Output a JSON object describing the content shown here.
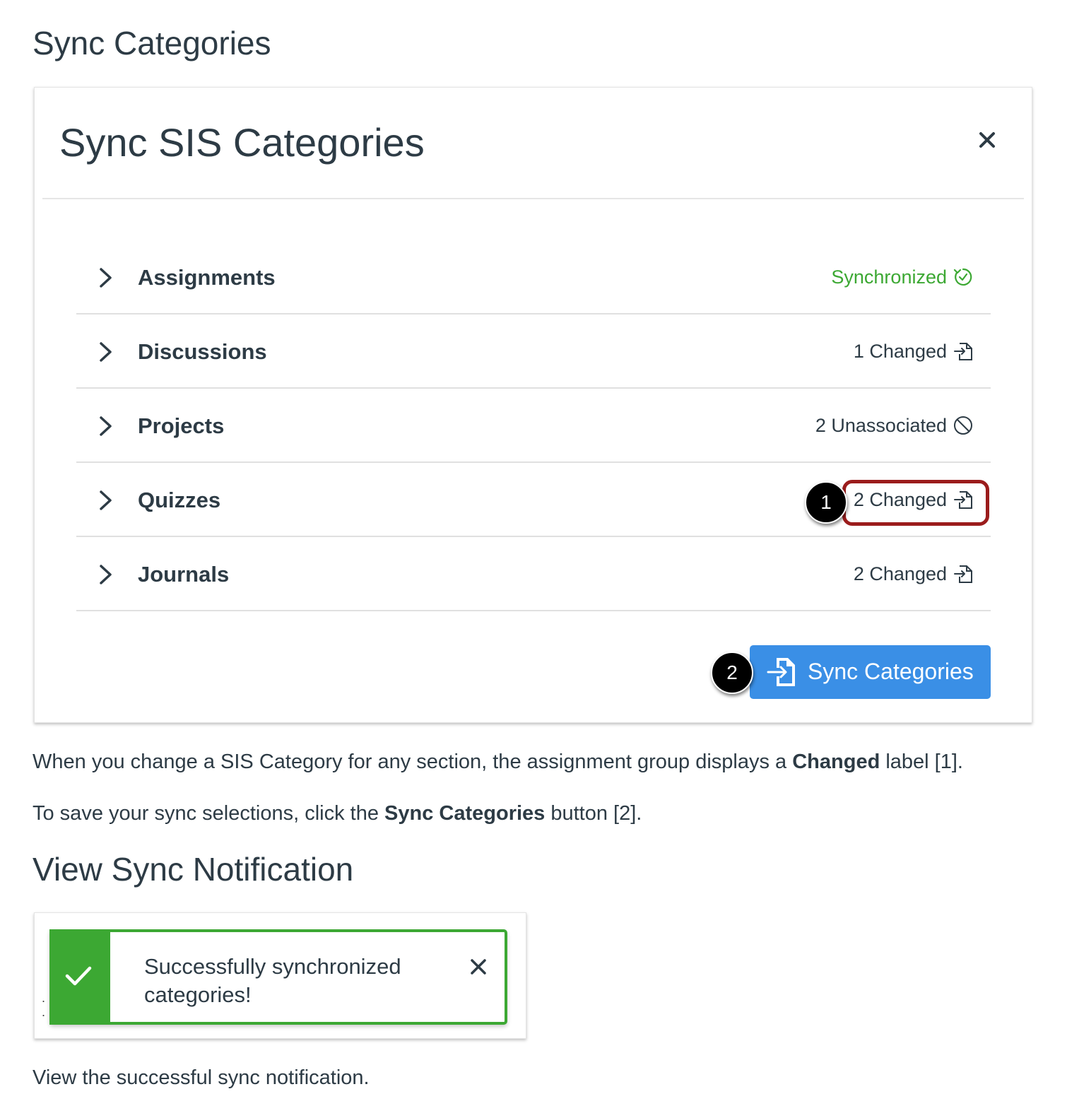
{
  "headings": {
    "sync_categories": "Sync Categories",
    "view_sync_notification": "View Sync Notification"
  },
  "modal": {
    "title": "Sync SIS Categories",
    "rows": [
      {
        "name": "Assignments",
        "status": "Synchronized",
        "status_icon": "synchronized-check-icon"
      },
      {
        "name": "Discussions",
        "status": "1 Changed",
        "status_icon": "changed-file-icon"
      },
      {
        "name": "Projects",
        "status": "2 Unassociated",
        "status_icon": "unassociated-icon"
      },
      {
        "name": "Quizzes",
        "status": "2 Changed",
        "status_icon": "changed-file-icon"
      },
      {
        "name": "Journals",
        "status": "2 Changed",
        "status_icon": "changed-file-icon"
      }
    ],
    "sync_button_label": "Sync Categories"
  },
  "callouts": {
    "badge1": "1",
    "badge2": "2"
  },
  "paragraphs": {
    "p1_pre": "When you change a SIS Category for any section, the assignment group displays a ",
    "p1_bold": "Changed",
    "p1_post": " label [1].",
    "p2_pre": "To save your sync selections, click the ",
    "p2_bold": "Sync Categories",
    "p2_post": " button [2].",
    "p3": "View the successful sync notification."
  },
  "notification": {
    "message": "Successfully synchronized categories!"
  },
  "colors": {
    "success_green": "#3ca833",
    "button_blue": "#3a8fe6",
    "highlight_red": "#9b1c1c",
    "text_dark": "#2d3b45"
  }
}
